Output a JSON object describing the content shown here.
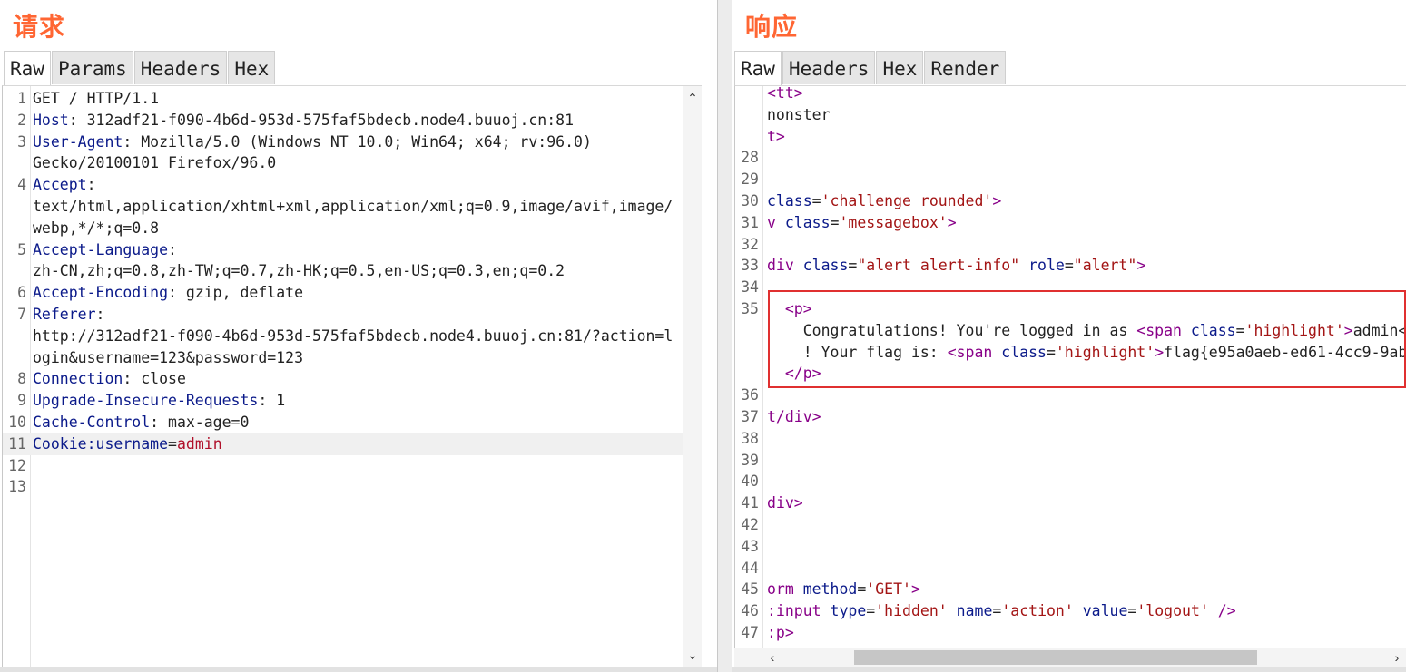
{
  "request": {
    "title": "请求",
    "tabs": [
      "Raw",
      "Params",
      "Headers",
      "Hex"
    ],
    "active_tab": "Raw",
    "lines": [
      {
        "n": "1",
        "parts": [
          {
            "t": "GET / HTTP/1.1",
            "c": "v"
          }
        ]
      },
      {
        "n": "2",
        "parts": [
          {
            "t": "Host",
            "c": "k"
          },
          {
            "t": ": 312adf21-f090-4b6d-953d-575faf5bdecb.node4.buuoj.cn:81",
            "c": "v"
          }
        ]
      },
      {
        "n": "3",
        "parts": [
          {
            "t": "User-Agent",
            "c": "k"
          },
          {
            "t": ": Mozilla/5.0 (Windows NT 10.0; Win64; x64; rv:96.0)",
            "c": "v"
          }
        ]
      },
      {
        "n": "",
        "parts": [
          {
            "t": "Gecko/20100101 Firefox/96.0",
            "c": "v"
          }
        ]
      },
      {
        "n": "4",
        "parts": [
          {
            "t": "Accept",
            "c": "k"
          },
          {
            "t": ":",
            "c": "v"
          }
        ]
      },
      {
        "n": "",
        "parts": [
          {
            "t": "text/html,application/xhtml+xml,application/xml;q=0.9,image/avif,image/",
            "c": "v"
          }
        ]
      },
      {
        "n": "",
        "parts": [
          {
            "t": "webp,*/*;q=0.8",
            "c": "v"
          }
        ]
      },
      {
        "n": "5",
        "parts": [
          {
            "t": "Accept-Language",
            "c": "k"
          },
          {
            "t": ":",
            "c": "v"
          }
        ]
      },
      {
        "n": "",
        "parts": [
          {
            "t": "zh-CN,zh;q=0.8,zh-TW;q=0.7,zh-HK;q=0.5,en-US;q=0.3,en;q=0.2",
            "c": "v"
          }
        ]
      },
      {
        "n": "6",
        "parts": [
          {
            "t": "Accept-Encoding",
            "c": "k"
          },
          {
            "t": ": gzip, deflate",
            "c": "v"
          }
        ]
      },
      {
        "n": "7",
        "parts": [
          {
            "t": "Referer",
            "c": "k"
          },
          {
            "t": ":",
            "c": "v"
          }
        ]
      },
      {
        "n": "",
        "parts": [
          {
            "t": "http://312adf21-f090-4b6d-953d-575faf5bdecb.node4.buuoj.cn:81/?action=l",
            "c": "v"
          }
        ]
      },
      {
        "n": "",
        "parts": [
          {
            "t": "ogin&username=123&password=123",
            "c": "v"
          }
        ]
      },
      {
        "n": "8",
        "parts": [
          {
            "t": "Connection",
            "c": "k"
          },
          {
            "t": ": close",
            "c": "v"
          }
        ]
      },
      {
        "n": "9",
        "parts": [
          {
            "t": "Upgrade-Insecure-Requests",
            "c": "k"
          },
          {
            "t": ": 1",
            "c": "v"
          }
        ]
      },
      {
        "n": "10",
        "parts": [
          {
            "t": "Cache-Control",
            "c": "k"
          },
          {
            "t": ": max-age=0",
            "c": "v"
          }
        ]
      },
      {
        "n": "11",
        "hl": true,
        "parts": [
          {
            "t": "Cookie:",
            "c": "k"
          },
          {
            "t": "username",
            "c": "k"
          },
          {
            "t": "=",
            "c": "v"
          },
          {
            "t": "admin",
            "c": "red"
          }
        ]
      },
      {
        "n": "12",
        "parts": []
      },
      {
        "n": "13",
        "parts": []
      }
    ]
  },
  "response": {
    "title": "响应",
    "tabs": [
      "Raw",
      "Headers",
      "Hex",
      "Render"
    ],
    "active_tab": "Raw",
    "lines": [
      {
        "n": "",
        "parts": [
          {
            "t": "<tt>",
            "c": "tag"
          }
        ]
      },
      {
        "n": "",
        "parts": [
          {
            "t": "nonster",
            "c": "v"
          }
        ]
      },
      {
        "n": "",
        "parts": [
          {
            "t": "t>",
            "c": "tag"
          }
        ]
      },
      {
        "n": "28",
        "parts": []
      },
      {
        "n": "29",
        "parts": []
      },
      {
        "n": "30",
        "parts": [
          {
            "t": "class",
            "c": "attr"
          },
          {
            "t": "=",
            "c": "v"
          },
          {
            "t": "'challenge rounded'",
            "c": "str"
          },
          {
            "t": ">",
            "c": "tag"
          }
        ]
      },
      {
        "n": "31",
        "parts": [
          {
            "t": "v ",
            "c": "tag"
          },
          {
            "t": "class",
            "c": "attr"
          },
          {
            "t": "=",
            "c": "v"
          },
          {
            "t": "'messagebox'",
            "c": "str"
          },
          {
            "t": ">",
            "c": "tag"
          }
        ]
      },
      {
        "n": "32",
        "parts": []
      },
      {
        "n": "33",
        "parts": [
          {
            "t": "div ",
            "c": "tag"
          },
          {
            "t": "class",
            "c": "attr"
          },
          {
            "t": "=",
            "c": "v"
          },
          {
            "t": "\"alert alert-info\"",
            "c": "str"
          },
          {
            "t": " role",
            "c": "attr"
          },
          {
            "t": "=",
            "c": "v"
          },
          {
            "t": "\"alert\"",
            "c": "str"
          },
          {
            "t": ">",
            "c": "tag"
          }
        ]
      },
      {
        "n": "34",
        "parts": []
      },
      {
        "n": "35",
        "parts": [
          {
            "t": "  <p>",
            "c": "tag"
          }
        ]
      },
      {
        "n": "",
        "parts": [
          {
            "t": "    Congratulations! You're logged in as ",
            "c": "v"
          },
          {
            "t": "<span ",
            "c": "tag"
          },
          {
            "t": "class",
            "c": "attr"
          },
          {
            "t": "=",
            "c": "v"
          },
          {
            "t": "'highlight'",
            "c": "str"
          },
          {
            "t": ">",
            "c": "tag"
          },
          {
            "t": "admin<",
            "c": "v"
          }
        ]
      },
      {
        "n": "",
        "parts": [
          {
            "t": "    ! Your flag is: ",
            "c": "v"
          },
          {
            "t": "<span ",
            "c": "tag"
          },
          {
            "t": "class",
            "c": "attr"
          },
          {
            "t": "=",
            "c": "v"
          },
          {
            "t": "'highlight'",
            "c": "str"
          },
          {
            "t": ">",
            "c": "tag"
          },
          {
            "t": "flag{e95a0aeb-ed61-4cc9-9ab",
            "c": "v"
          }
        ]
      },
      {
        "n": "",
        "parts": [
          {
            "t": "  </p>",
            "c": "tag"
          }
        ]
      },
      {
        "n": "36",
        "parts": []
      },
      {
        "n": "37",
        "parts": [
          {
            "t": "t/div>",
            "c": "tag"
          }
        ]
      },
      {
        "n": "38",
        "parts": []
      },
      {
        "n": "39",
        "parts": []
      },
      {
        "n": "40",
        "parts": []
      },
      {
        "n": "41",
        "parts": [
          {
            "t": "div>",
            "c": "tag"
          }
        ]
      },
      {
        "n": "42",
        "parts": []
      },
      {
        "n": "43",
        "parts": []
      },
      {
        "n": "44",
        "parts": []
      },
      {
        "n": "45",
        "parts": [
          {
            "t": "orm ",
            "c": "tag"
          },
          {
            "t": "method",
            "c": "attr"
          },
          {
            "t": "=",
            "c": "v"
          },
          {
            "t": "'GET'",
            "c": "str"
          },
          {
            "t": ">",
            "c": "tag"
          }
        ]
      },
      {
        "n": "46",
        "parts": [
          {
            "t": ":input ",
            "c": "tag"
          },
          {
            "t": "type",
            "c": "attr"
          },
          {
            "t": "=",
            "c": "v"
          },
          {
            "t": "'hidden'",
            "c": "str"
          },
          {
            "t": " name",
            "c": "attr"
          },
          {
            "t": "=",
            "c": "v"
          },
          {
            "t": "'action'",
            "c": "str"
          },
          {
            "t": " value",
            "c": "attr"
          },
          {
            "t": "=",
            "c": "v"
          },
          {
            "t": "'logout'",
            "c": "str"
          },
          {
            "t": " />",
            "c": "tag"
          }
        ]
      },
      {
        "n": "47",
        "parts": [
          {
            "t": ":p>",
            "c": "tag"
          }
        ]
      }
    ]
  },
  "icons": {
    "scroll_up": "chevron-up-icon",
    "scroll_down": "chevron-down-icon",
    "scroll_left": "chevron-left-icon",
    "scroll_right": "chevron-right-icon"
  },
  "colors": {
    "title": "#ff6633",
    "highlight_box": "#e03030"
  }
}
